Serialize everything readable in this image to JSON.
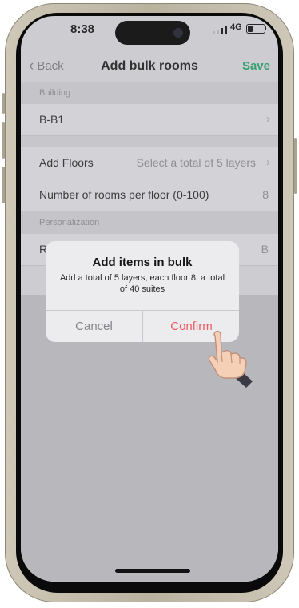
{
  "status": {
    "time": "8:38",
    "network": "4G",
    "battery_fraction": 0.3
  },
  "nav": {
    "back_label": "Back",
    "title": "Add bulk rooms",
    "save_label": "Save"
  },
  "sections": {
    "building": {
      "header": "Building",
      "value": "B-B1"
    },
    "floors": {
      "label": "Add Floors",
      "value": "Select a total of 5 layers"
    },
    "rooms_per_floor": {
      "label": "Number of rooms per floor (0-100)",
      "value": "8"
    },
    "personalization": {
      "header": "Personalization",
      "room_label": "Room",
      "room_value": "B"
    }
  },
  "dialog": {
    "title": "Add items in bulk",
    "message": "Add a total of 5 layers, each floor 8, a total of 40 suites",
    "cancel_label": "Cancel",
    "confirm_label": "Confirm"
  },
  "colors": {
    "accent_green": "#20a368",
    "confirm_red": "#ec5a62"
  }
}
